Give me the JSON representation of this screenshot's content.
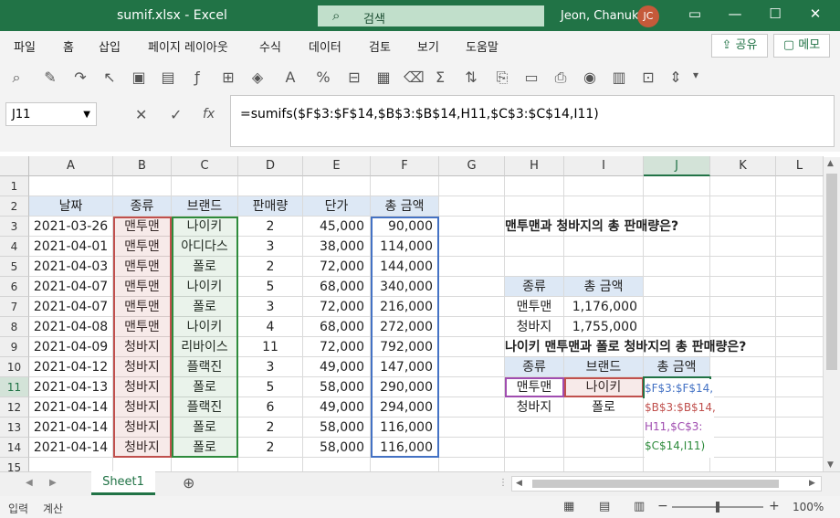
{
  "window": {
    "title": "sumif.xlsx  -  Excel",
    "search_placeholder": "검색",
    "user_name": "Jeon, Chanuk",
    "user_initials": "JC"
  },
  "menu": {
    "items": [
      "파일",
      "홈",
      "삽입",
      "페이지 레이아웃",
      "수식",
      "데이터",
      "검토",
      "보기",
      "도움말"
    ],
    "share": "공유",
    "memo": "메모"
  },
  "formula_bar": {
    "name_box": "J11",
    "formula": "=sumifs($F$3:$F$14,$B$3:$B$14,H11,$C$3:$C$14,I11)",
    "fx": "fx"
  },
  "columns": [
    "A",
    "B",
    "C",
    "D",
    "E",
    "F",
    "G",
    "H",
    "I",
    "J",
    "K",
    "L"
  ],
  "rows": [
    "1",
    "2",
    "3",
    "4",
    "5",
    "6",
    "7",
    "8",
    "9",
    "10",
    "11",
    "12",
    "13",
    "14",
    "15"
  ],
  "table": {
    "headers": [
      "날짜",
      "종류",
      "브랜드",
      "판매량",
      "단가",
      "총 금액"
    ],
    "data": [
      [
        "2021-03-26",
        "맨투맨",
        "나이키",
        "2",
        "45,000",
        "90,000"
      ],
      [
        "2021-04-01",
        "맨투맨",
        "아디다스",
        "3",
        "38,000",
        "114,000"
      ],
      [
        "2021-04-03",
        "맨투맨",
        "폴로",
        "2",
        "72,000",
        "144,000"
      ],
      [
        "2021-04-07",
        "맨투맨",
        "나이키",
        "5",
        "68,000",
        "340,000"
      ],
      [
        "2021-04-07",
        "맨투맨",
        "폴로",
        "3",
        "72,000",
        "216,000"
      ],
      [
        "2021-04-08",
        "맨투맨",
        "나이키",
        "4",
        "68,000",
        "272,000"
      ],
      [
        "2021-04-09",
        "청바지",
        "리바이스",
        "11",
        "72,000",
        "792,000"
      ],
      [
        "2021-04-12",
        "청바지",
        "플랙진",
        "3",
        "49,000",
        "147,000"
      ],
      [
        "2021-04-13",
        "청바지",
        "폴로",
        "5",
        "58,000",
        "290,000"
      ],
      [
        "2021-04-14",
        "청바지",
        "플랙진",
        "6",
        "49,000",
        "294,000"
      ],
      [
        "2021-04-14",
        "청바지",
        "폴로",
        "2",
        "58,000",
        "116,000"
      ],
      [
        "2021-04-14",
        "청바지",
        "폴로",
        "2",
        "58,000",
        "116,000"
      ]
    ]
  },
  "question1": {
    "text": "맨투맨과 청바지의 총 판매량은?",
    "headers": [
      "종류",
      "총 금액"
    ],
    "rows": [
      [
        "맨투맨",
        "1,176,000"
      ],
      [
        "청바지",
        "1,755,000"
      ]
    ]
  },
  "question2": {
    "text": "나이키 맨투맨과 폴로 청바지의 총 판매량은?",
    "headers": [
      "종류",
      "브랜드",
      "총 금액"
    ],
    "rows": [
      [
        "맨투맨",
        "나이키"
      ],
      [
        "청바지",
        "폴로"
      ]
    ],
    "edit_lines": [
      "$F$3:$F$14,",
      "$B$3:$B$14,",
      "H11,$C$3:",
      "$C$14,I11)"
    ]
  },
  "sheet_tab": "Sheet1",
  "status": {
    "mode": "입력",
    "accessibility": "계산",
    "zoom": "100%"
  },
  "colors": {
    "brand": "#217346",
    "range_red": "#c0504d",
    "range_green": "#2e8b3c",
    "range_blue": "#4472c4",
    "range_purple": "#a04db0",
    "header_fill": "#dde8f5"
  }
}
